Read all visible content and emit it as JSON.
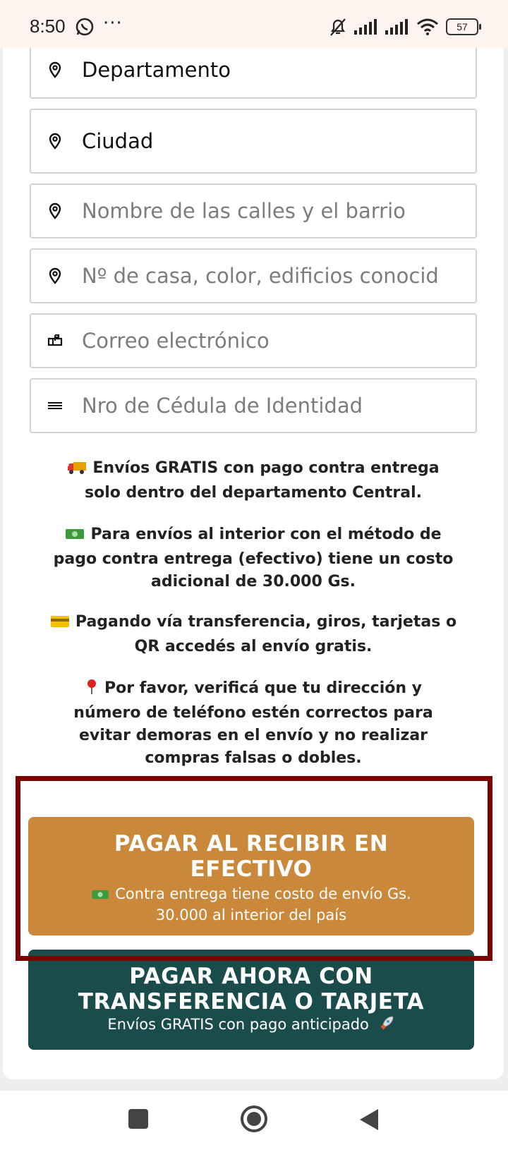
{
  "status_bar": {
    "time": "8:50",
    "more": "···",
    "battery": "57"
  },
  "form": {
    "department": {
      "value": "Departamento",
      "icon": "location-pin-icon"
    },
    "city": {
      "value": "Ciudad",
      "icon": "location-pin-icon"
    },
    "streets": {
      "placeholder": "Nombre de las calles y el barrio",
      "icon": "location-pin-icon"
    },
    "house_number": {
      "placeholder": "Nº de casa, color, edificios conocid",
      "icon": "location-pin-icon"
    },
    "email": {
      "placeholder": "Correo electrónico",
      "icon": "mailbox-icon"
    },
    "id_number": {
      "placeholder": "Nro de Cédula de Identidad",
      "icon": "menu-lines-icon"
    }
  },
  "notices": {
    "free_shipping_line1": "Envíos GRATIS con pago contra entrega",
    "free_shipping_line2": "solo dentro del departamento Central.",
    "interior_line1": "Para envíos al interior con el método de",
    "interior_line2": "pago contra entrega (efectivo) tiene un costo",
    "interior_line3": "adicional de 30.000 Gs.",
    "transfer_line1": "Pagando vía transferencia, giros, tarjetas o",
    "transfer_line2": "QR accedés al envío gratis.",
    "verify_line1": "Por favor, verificá que tu dirección y",
    "verify_line2": "número de teléfono estén correctos para",
    "verify_line3": "evitar demoras en el envío y no realizar",
    "verify_line4": "compras falsas o dobles."
  },
  "buttons": {
    "cod": {
      "title_line1": "PAGAR AL RECIBIR EN",
      "title_line2": "EFECTIVO",
      "sub_line1": "Contra entrega tiene costo de envío Gs.",
      "sub_line2": "30.000 al interior del país",
      "color": "#c9883a"
    },
    "pay_now": {
      "title_line1": "PAGAR AHORA CON",
      "title_line2": "TRANSFERENCIA O TARJETA",
      "sub": "Envíos GRATIS con pago anticipado",
      "color": "#1a4c4b"
    }
  },
  "highlight_color": "#7a0000"
}
